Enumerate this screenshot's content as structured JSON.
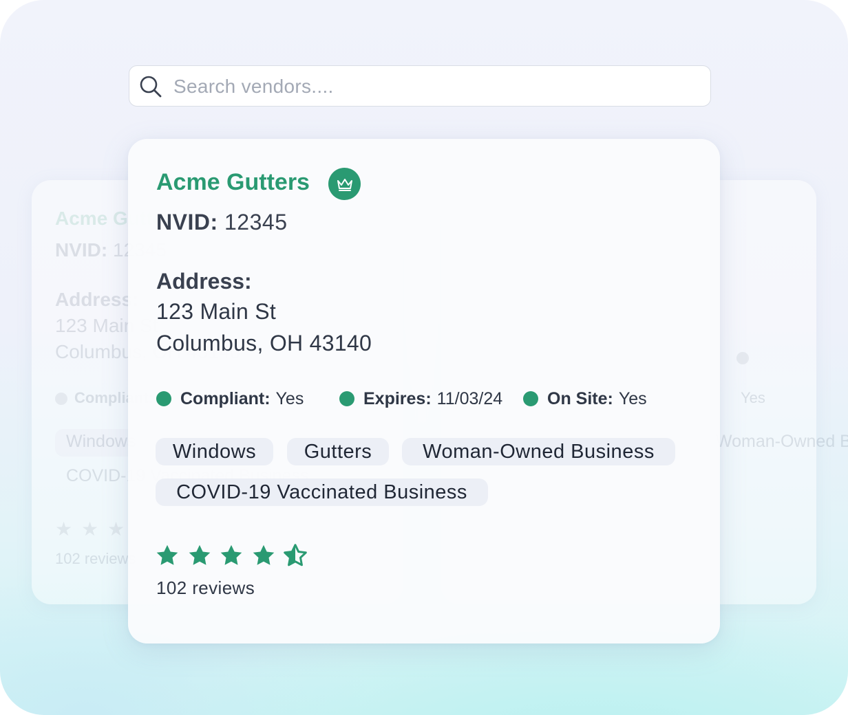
{
  "search": {
    "placeholder": "Search vendors...."
  },
  "vendor": {
    "name": "Acme Gutters",
    "nvid_label": "NVID:",
    "nvid_value": "12345",
    "address_label": "Address:",
    "address_line1": "123 Main St",
    "address_line2": "Columbus, OH 43140",
    "status": [
      {
        "label": "Compliant:",
        "value": "Yes"
      },
      {
        "label": "Expires:",
        "value": "11/03/24"
      },
      {
        "label": "On Site:",
        "value": "Yes"
      }
    ],
    "tags": [
      "Windows",
      "Gutters",
      "Woman-Owned Business",
      "COVID-19 Vaccinated Business"
    ],
    "rating": 4.5,
    "reviews": "102 reviews"
  },
  "colors": {
    "accent": "#2a9a72",
    "text": "#2f3746",
    "tag_bg": "#eceff6"
  },
  "icons": [
    "search-icon",
    "crown-icon",
    "star-icon",
    "half-star-icon"
  ]
}
